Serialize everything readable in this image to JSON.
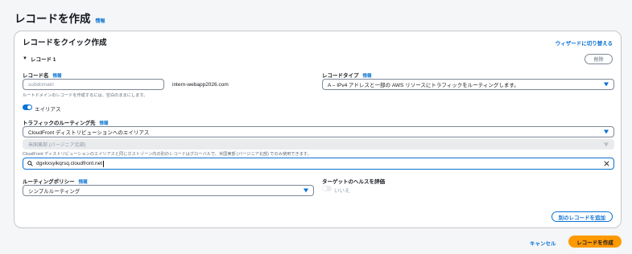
{
  "page": {
    "title": "レコードを作成",
    "info": "情報"
  },
  "card": {
    "title": "レコードをクイック作成",
    "wizard_link": "ウィザードに切り替える",
    "record_toggle": "レコード 1",
    "delete_button": "削除"
  },
  "record_name": {
    "label": "レコード名",
    "info": "情報",
    "placeholder": "subdomain",
    "suffix": "intern-webapp2026.com",
    "hint": "ルートドメインのレコードを作成するには、空白のままにします。"
  },
  "record_type": {
    "label": "レコードタイプ",
    "info": "情報",
    "value": "A – IPv4 アドレスと一部の AWS リソースにトラフィックをルーティングします。"
  },
  "alias": {
    "label": "エイリアス",
    "enabled": true
  },
  "route_traffic": {
    "label": "トラフィックのルーティング先",
    "info": "情報",
    "endpoint_value": "CloudFront ディストリビューションへのエイリアス",
    "region_value": "米国東部 (バージニア北部)",
    "region_hint": "CloudFront ディストリビューションのエイリアスと同じホストゾーン内の別のレコードはグローバルで、米国東部 (バージニア北部) でのみ使用できます。",
    "search_value": "dgxkxsyikqrsq.cloudfront.net"
  },
  "routing_policy": {
    "label": "ルーティングポリシー",
    "info": "情報",
    "value": "シンプルルーティング"
  },
  "health": {
    "label": "ターゲットのヘルスを評価",
    "toggle_text": "いいえ",
    "enabled": false
  },
  "footer": {
    "add_record": "別のレコードを追加",
    "cancel": "キャンセル",
    "create": "レコードを作成"
  },
  "colors": {
    "accent": "#0972d3",
    "primary_button": "#ff9900"
  }
}
